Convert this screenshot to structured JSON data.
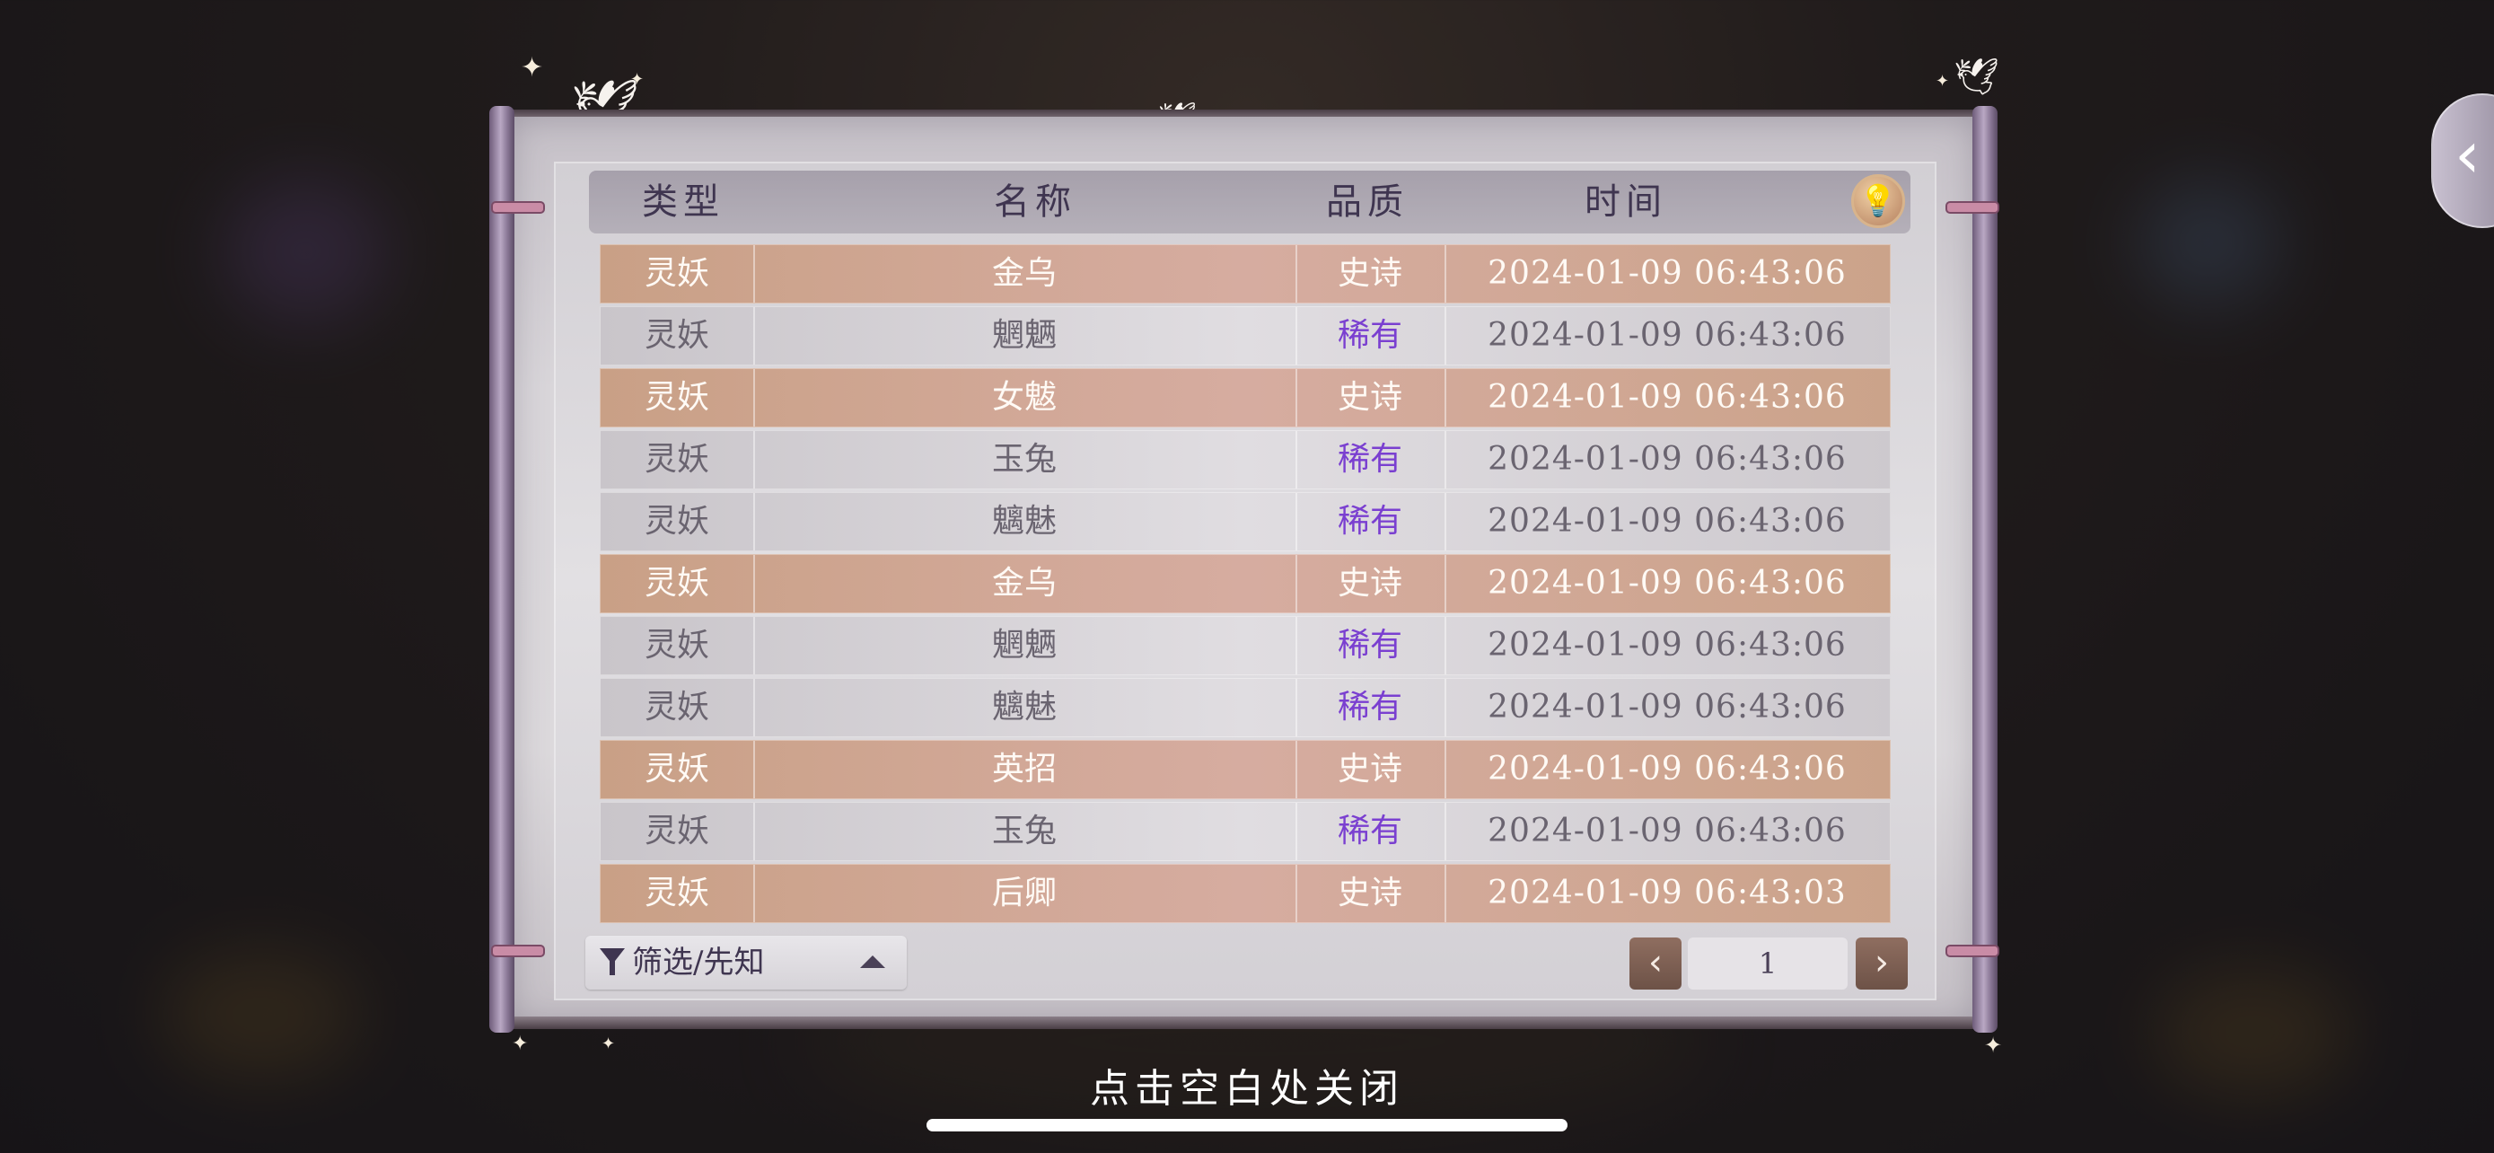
{
  "header": {
    "type_label": "类型",
    "name_label": "名称",
    "quality_label": "品质",
    "time_label": "时间",
    "hint_icon": "lightbulb-icon"
  },
  "rows": [
    {
      "type": "灵妖",
      "name": "金乌",
      "quality": "史诗",
      "time": "2024-01-09  06:43:06",
      "style": "epic"
    },
    {
      "type": "灵妖",
      "name": "魍魉",
      "quality": "稀有",
      "time": "2024-01-09  06:43:06",
      "style": "rare"
    },
    {
      "type": "灵妖",
      "name": "女魃",
      "quality": "史诗",
      "time": "2024-01-09  06:43:06",
      "style": "epic"
    },
    {
      "type": "灵妖",
      "name": "玉兔",
      "quality": "稀有",
      "time": "2024-01-09  06:43:06",
      "style": "rare"
    },
    {
      "type": "灵妖",
      "name": "魑魅",
      "quality": "稀有",
      "time": "2024-01-09  06:43:06",
      "style": "rare"
    },
    {
      "type": "灵妖",
      "name": "金乌",
      "quality": "史诗",
      "time": "2024-01-09  06:43:06",
      "style": "epic"
    },
    {
      "type": "灵妖",
      "name": "魍魉",
      "quality": "稀有",
      "time": "2024-01-09  06:43:06",
      "style": "rare"
    },
    {
      "type": "灵妖",
      "name": "魑魅",
      "quality": "稀有",
      "time": "2024-01-09  06:43:06",
      "style": "rare"
    },
    {
      "type": "灵妖",
      "name": "英招",
      "quality": "史诗",
      "time": "2024-01-09  06:43:06",
      "style": "epic"
    },
    {
      "type": "灵妖",
      "name": "玉兔",
      "quality": "稀有",
      "time": "2024-01-09  06:43:06",
      "style": "rare"
    },
    {
      "type": "灵妖",
      "name": "后卿",
      "quality": "史诗",
      "time": "2024-01-09  06:43:03",
      "style": "epic"
    }
  ],
  "footer": {
    "filter_label": "筛选/先知",
    "filter_icon": "funnel-icon",
    "page_number": "1",
    "prev_icon": "chevron-left-icon",
    "next_icon": "chevron-right-icon"
  },
  "close_hint": "点击空白处关闭",
  "side_button_icon": "chevron-left-icon",
  "colors": {
    "epic_row": "#d1a794",
    "rare_row": "#d8d5d9",
    "rare_text": "#7a3fd0",
    "header_text": "#3f3550"
  }
}
